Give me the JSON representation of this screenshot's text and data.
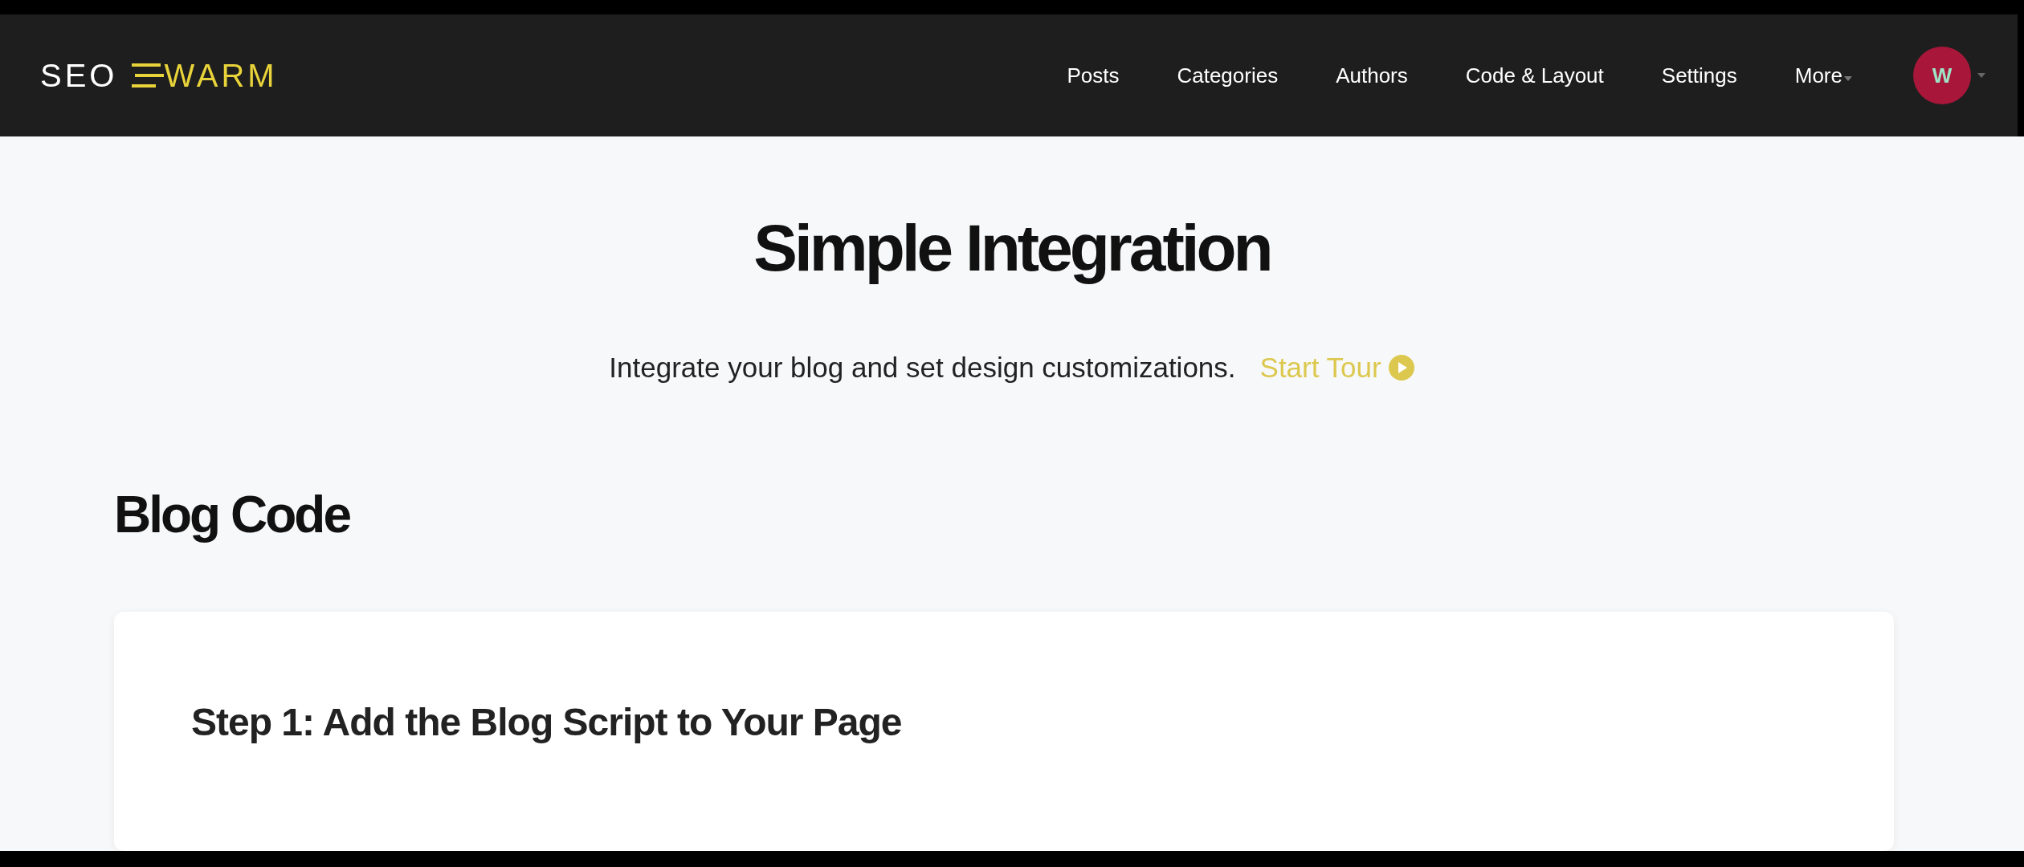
{
  "navbar": {
    "logo": {
      "first_word": "SEO",
      "second_word": "WARM"
    },
    "items": [
      {
        "label": "Posts",
        "kind": "link"
      },
      {
        "label": "Categories",
        "kind": "link"
      },
      {
        "label": "Authors",
        "kind": "link"
      },
      {
        "label": "Code & Layout",
        "kind": "link"
      },
      {
        "label": "Settings",
        "kind": "link"
      },
      {
        "label": "More",
        "kind": "dropdown"
      }
    ],
    "avatar": {
      "initial": "W",
      "color": "#a8173a"
    }
  },
  "page": {
    "title": "Simple Integration",
    "subtitle": "Integrate your blog and set design customizations.",
    "tour_link": "Start Tour"
  },
  "section": {
    "heading": "Blog Code",
    "card": {
      "step_heading": "Step 1: Add the Blog Script to Your Page"
    }
  }
}
